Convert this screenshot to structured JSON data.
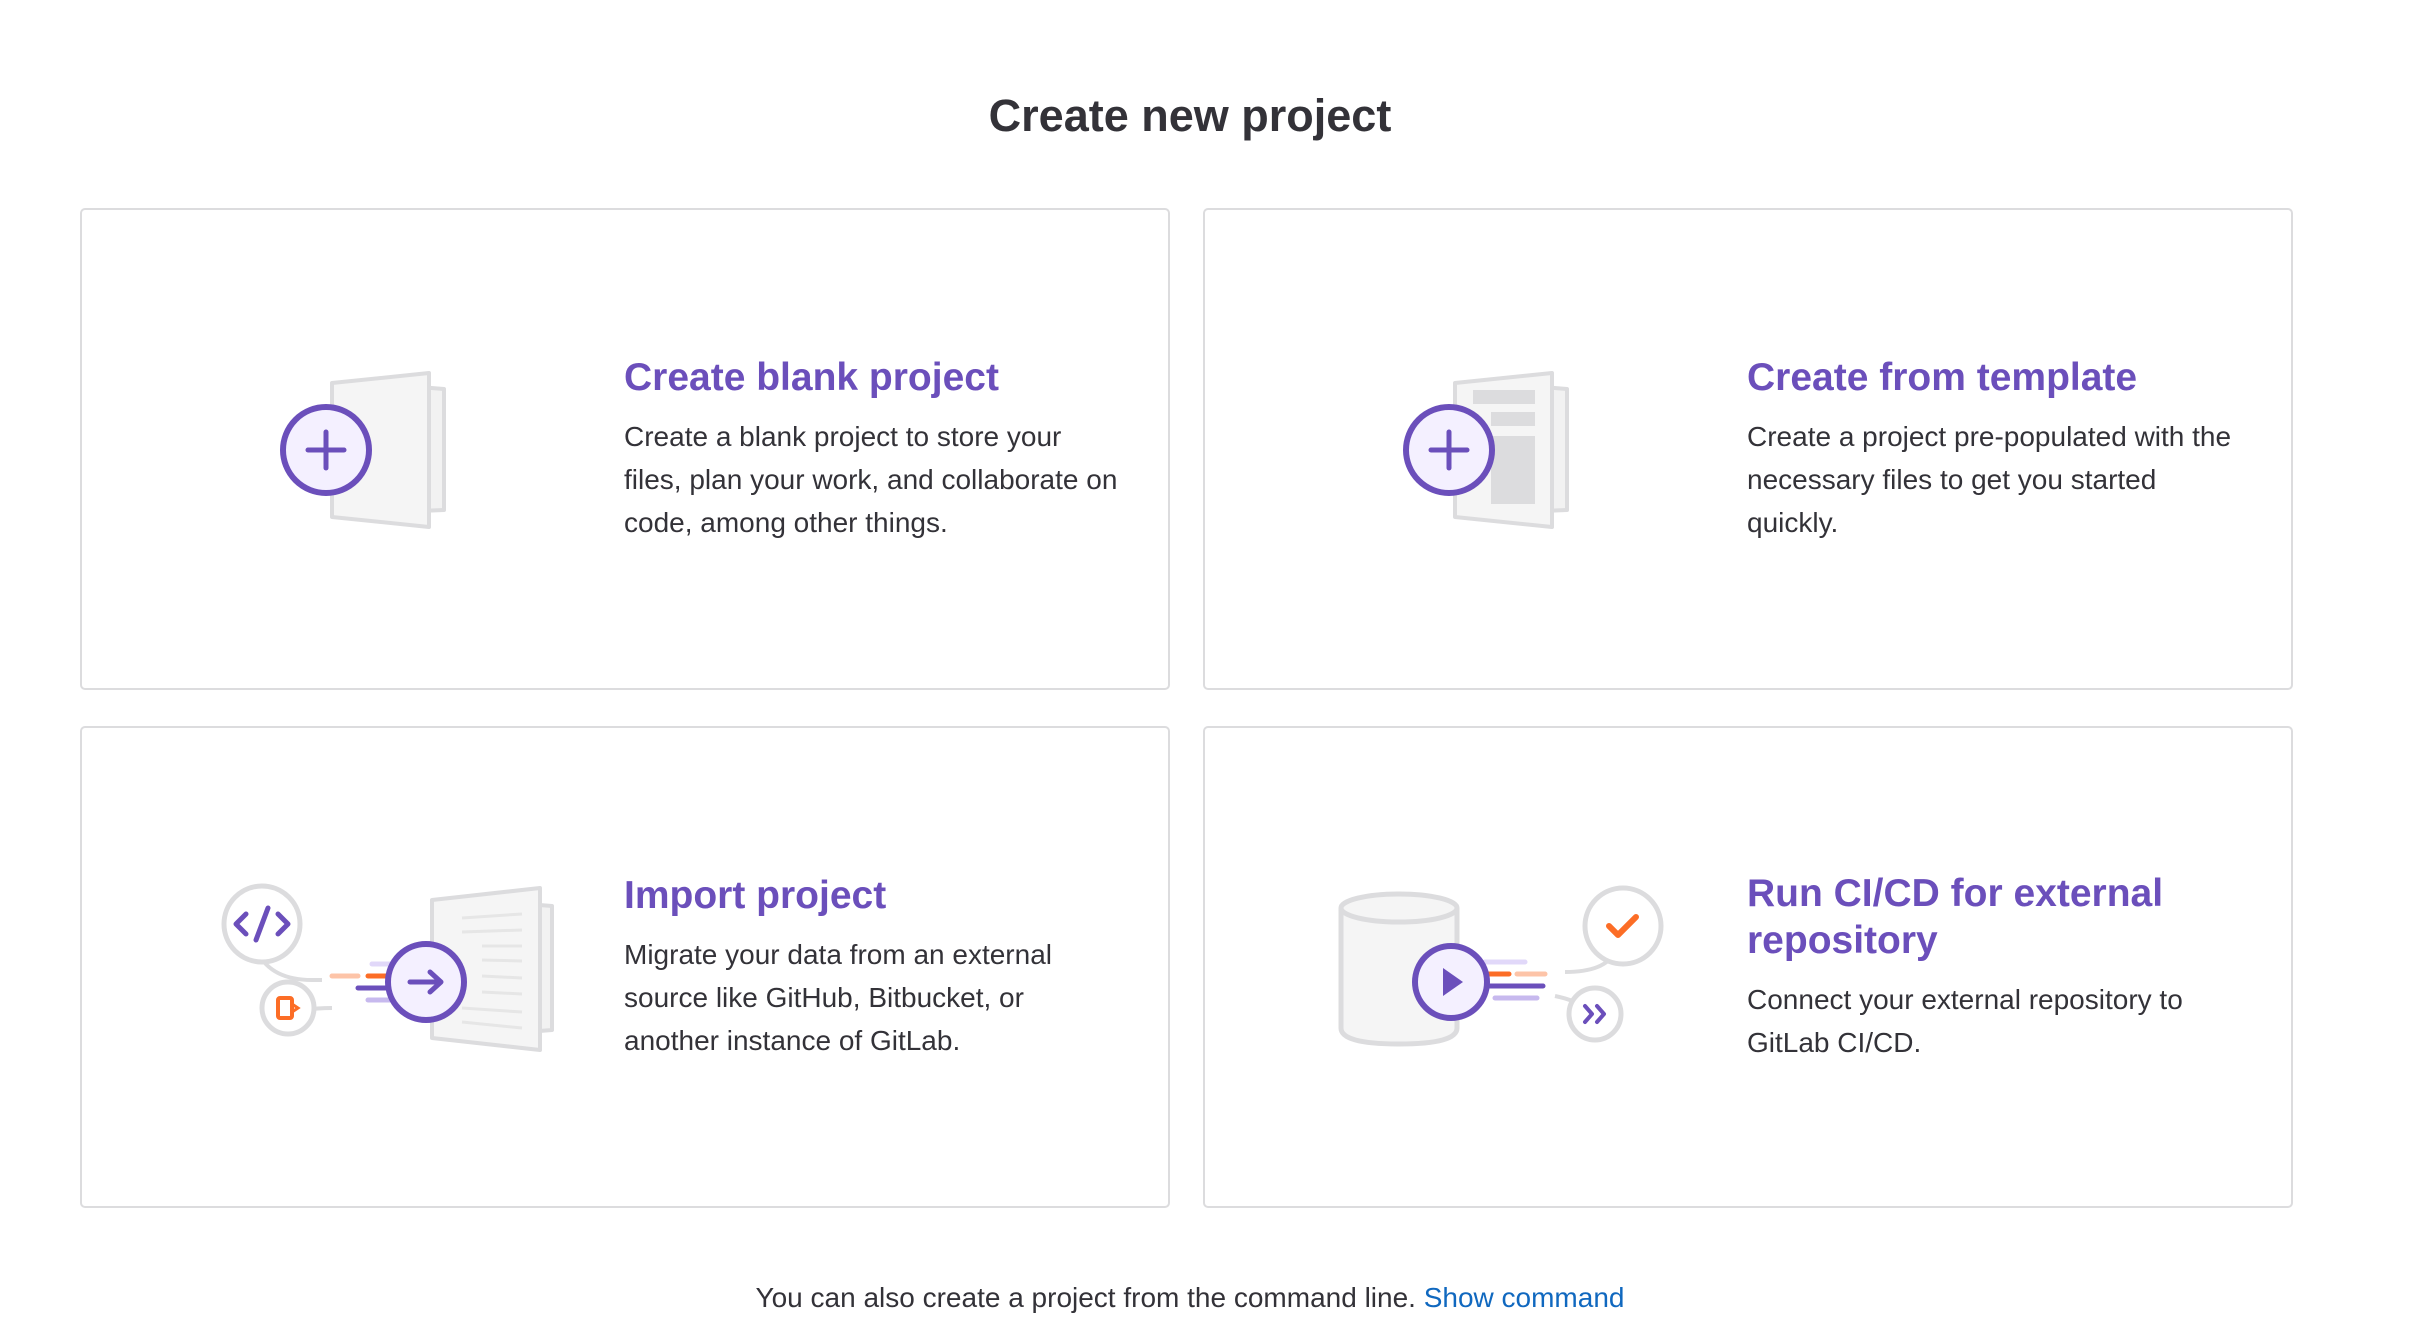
{
  "page": {
    "title": "Create new project"
  },
  "cards": [
    {
      "title": "Create blank project",
      "description": "Create a blank project to store your files, plan your work, and collaborate on code, among other things.",
      "icon": "blank-project-illustration"
    },
    {
      "title": "Create from template",
      "description": "Create a project pre-populated with the necessary files to get you started quickly.",
      "icon": "template-project-illustration"
    },
    {
      "title": "Import project",
      "description": "Migrate your data from an external source like GitHub, Bitbucket, or another instance of GitLab.",
      "icon": "import-project-illustration"
    },
    {
      "title": "Run CI/CD for external repository",
      "description": "Connect your external repository to GitLab CI/CD.",
      "icon": "cicd-external-repo-illustration"
    }
  ],
  "footer": {
    "text": "You can also create a project from the command line.",
    "link_label": "Show command"
  },
  "colors": {
    "accent_purple": "#6b4fbb",
    "accent_orange": "#fc6d26",
    "link_blue": "#1068bf",
    "border": "#dcdcde"
  }
}
